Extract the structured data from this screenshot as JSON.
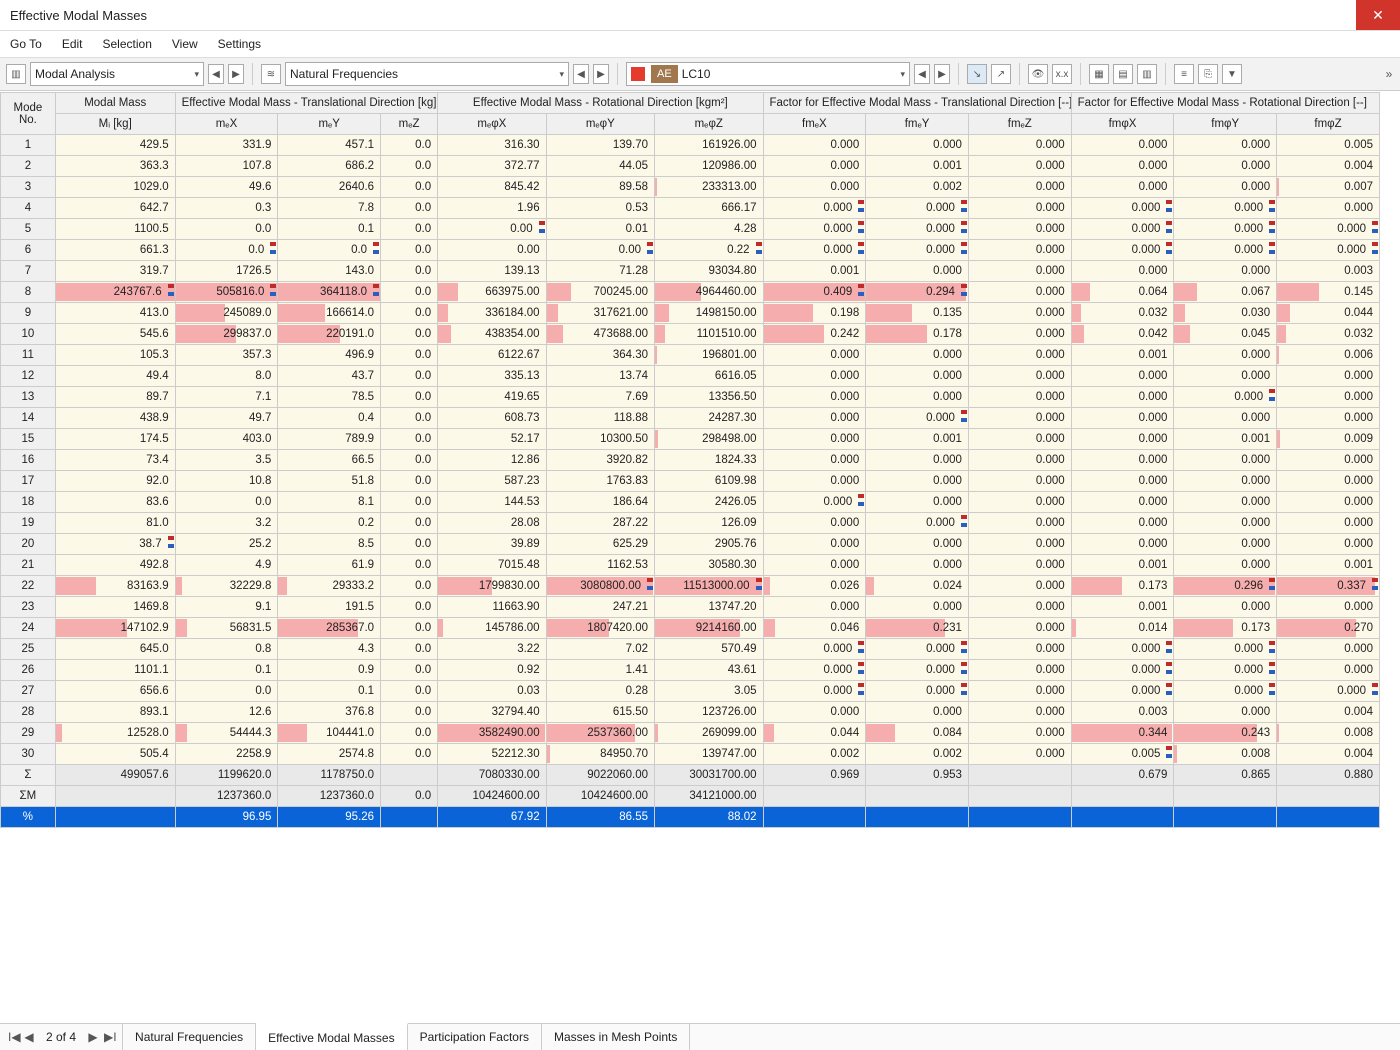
{
  "window": {
    "title": "Effective Modal Masses"
  },
  "menu": [
    "Go To",
    "Edit",
    "Selection",
    "View",
    "Settings"
  ],
  "toolbar": {
    "analysis": "Modal Analysis",
    "result": "Natural Frequencies",
    "case_code": "AE",
    "case": "LC10",
    "swatch": "#e43b2c"
  },
  "pager": {
    "text": "2 of 4"
  },
  "tabs": [
    "Natural Frequencies",
    "Effective Modal Masses",
    "Participation Factors",
    "Masses in Mesh Points"
  ],
  "active_tab": 1,
  "headers": {
    "row": "Mode\nNo.",
    "g1": "Modal Mass",
    "g2": "Effective Modal Mass - Translational Direction [kg]",
    "g3": "Effective Modal Mass - Rotational Direction [kgm²]",
    "g4": "Factor for Effective Modal Mass - Translational Direction [--]",
    "g5": "Factor for Effective Modal Mass - Rotational Direction [--]",
    "cols": [
      "Mᵢ [kg]",
      "mₑX",
      "mₑY",
      "mₑZ",
      "mₑφX",
      "mₑφY",
      "mₑφZ",
      "fmₑX",
      "fmₑY",
      "fmₑZ",
      "fmφX",
      "fmφY",
      "fmφZ"
    ]
  },
  "column_scales": [
    244000,
    506000,
    365000,
    1,
    3600000,
    3100000,
    11600000,
    0.41,
    0.3,
    0.01,
    0.35,
    0.3,
    0.35
  ],
  "rows": [
    {
      "n": "1",
      "v": [
        "429.5",
        "331.9",
        "457.1",
        "0.0",
        "316.30",
        "139.70",
        "161926.00",
        "0.000",
        "0.000",
        "0.000",
        "0.000",
        "0.000",
        "0.005"
      ],
      "f": {}
    },
    {
      "n": "2",
      "v": [
        "363.3",
        "107.8",
        "686.2",
        "0.0",
        "372.77",
        "44.05",
        "120986.00",
        "0.000",
        "0.001",
        "0.000",
        "0.000",
        "0.000",
        "0.004"
      ],
      "f": {}
    },
    {
      "n": "3",
      "v": [
        "1029.0",
        "49.6",
        "2640.6",
        "0.0",
        "845.42",
        "89.58",
        "233313.00",
        "0.000",
        "0.002",
        "0.000",
        "0.000",
        "0.000",
        "0.007"
      ],
      "f": {}
    },
    {
      "n": "4",
      "v": [
        "642.7",
        "0.3",
        "7.8",
        "0.0",
        "1.96",
        "0.53",
        "666.17",
        "0.000",
        "0.000",
        "0.000",
        "0.000",
        "0.000",
        "0.000"
      ],
      "f": {
        "7": 1,
        "8": 1,
        "10": 1,
        "11": 1
      }
    },
    {
      "n": "5",
      "v": [
        "1100.5",
        "0.0",
        "0.1",
        "0.0",
        "0.00",
        "0.01",
        "4.28",
        "0.000",
        "0.000",
        "0.000",
        "0.000",
        "0.000",
        "0.000"
      ],
      "f": {
        "4": 1,
        "7": 1,
        "8": 1,
        "10": 1,
        "11": 1,
        "12": 1
      }
    },
    {
      "n": "6",
      "v": [
        "661.3",
        "0.0",
        "0.0",
        "0.0",
        "0.00",
        "0.00",
        "0.22",
        "0.000",
        "0.000",
        "0.000",
        "0.000",
        "0.000",
        "0.000"
      ],
      "f": {
        "1": 1,
        "2": 1,
        "5": 1,
        "6": 1,
        "7": 1,
        "8": 1,
        "10": 1,
        "11": 1,
        "12": 1
      }
    },
    {
      "n": "7",
      "v": [
        "319.7",
        "1726.5",
        "143.0",
        "0.0",
        "139.13",
        "71.28",
        "93034.80",
        "0.001",
        "0.000",
        "0.000",
        "0.000",
        "0.000",
        "0.003"
      ],
      "f": {}
    },
    {
      "n": "8",
      "v": [
        "243767.6",
        "505816.0",
        "364118.0",
        "0.0",
        "663975.00",
        "700245.00",
        "4964460.00",
        "0.409",
        "0.294",
        "0.000",
        "0.064",
        "0.067",
        "0.145"
      ],
      "f": {
        "0": 1,
        "1": 1,
        "2": 1,
        "7": 1,
        "8": 1
      }
    },
    {
      "n": "9",
      "v": [
        "413.0",
        "245089.0",
        "166614.0",
        "0.0",
        "336184.00",
        "317621.00",
        "1498150.00",
        "0.198",
        "0.135",
        "0.000",
        "0.032",
        "0.030",
        "0.044"
      ],
      "f": {}
    },
    {
      "n": "10",
      "v": [
        "545.6",
        "299837.0",
        "220191.0",
        "0.0",
        "438354.00",
        "473688.00",
        "1101510.00",
        "0.242",
        "0.178",
        "0.000",
        "0.042",
        "0.045",
        "0.032"
      ],
      "f": {}
    },
    {
      "n": "11",
      "v": [
        "105.3",
        "357.3",
        "496.9",
        "0.0",
        "6122.67",
        "364.30",
        "196801.00",
        "0.000",
        "0.000",
        "0.000",
        "0.001",
        "0.000",
        "0.006"
      ],
      "f": {}
    },
    {
      "n": "12",
      "v": [
        "49.4",
        "8.0",
        "43.7",
        "0.0",
        "335.13",
        "13.74",
        "6616.05",
        "0.000",
        "0.000",
        "0.000",
        "0.000",
        "0.000",
        "0.000"
      ],
      "f": {}
    },
    {
      "n": "13",
      "v": [
        "89.7",
        "7.1",
        "78.5",
        "0.0",
        "419.65",
        "7.69",
        "13356.50",
        "0.000",
        "0.000",
        "0.000",
        "0.000",
        "0.000",
        "0.000"
      ],
      "f": {
        "11": 1
      }
    },
    {
      "n": "14",
      "v": [
        "438.9",
        "49.7",
        "0.4",
        "0.0",
        "608.73",
        "118.88",
        "24287.30",
        "0.000",
        "0.000",
        "0.000",
        "0.000",
        "0.000",
        "0.000"
      ],
      "f": {
        "8": 1
      }
    },
    {
      "n": "15",
      "v": [
        "174.5",
        "403.0",
        "789.9",
        "0.0",
        "52.17",
        "10300.50",
        "298498.00",
        "0.000",
        "0.001",
        "0.000",
        "0.000",
        "0.001",
        "0.009"
      ],
      "f": {}
    },
    {
      "n": "16",
      "v": [
        "73.4",
        "3.5",
        "66.5",
        "0.0",
        "12.86",
        "3920.82",
        "1824.33",
        "0.000",
        "0.000",
        "0.000",
        "0.000",
        "0.000",
        "0.000"
      ],
      "f": {}
    },
    {
      "n": "17",
      "v": [
        "92.0",
        "10.8",
        "51.8",
        "0.0",
        "587.23",
        "1763.83",
        "6109.98",
        "0.000",
        "0.000",
        "0.000",
        "0.000",
        "0.000",
        "0.000"
      ],
      "f": {}
    },
    {
      "n": "18",
      "v": [
        "83.6",
        "0.0",
        "8.1",
        "0.0",
        "144.53",
        "186.64",
        "2426.05",
        "0.000",
        "0.000",
        "0.000",
        "0.000",
        "0.000",
        "0.000"
      ],
      "f": {
        "7": 1
      }
    },
    {
      "n": "19",
      "v": [
        "81.0",
        "3.2",
        "0.2",
        "0.0",
        "28.08",
        "287.22",
        "126.09",
        "0.000",
        "0.000",
        "0.000",
        "0.000",
        "0.000",
        "0.000"
      ],
      "f": {
        "8": 1
      }
    },
    {
      "n": "20",
      "v": [
        "38.7",
        "25.2",
        "8.5",
        "0.0",
        "39.89",
        "625.29",
        "2905.76",
        "0.000",
        "0.000",
        "0.000",
        "0.000",
        "0.000",
        "0.000"
      ],
      "f": {
        "0": 1
      }
    },
    {
      "n": "21",
      "v": [
        "492.8",
        "4.9",
        "61.9",
        "0.0",
        "7015.48",
        "1162.53",
        "30580.30",
        "0.000",
        "0.000",
        "0.000",
        "0.001",
        "0.000",
        "0.001"
      ],
      "f": {}
    },
    {
      "n": "22",
      "v": [
        "83163.9",
        "32229.8",
        "29333.2",
        "0.0",
        "1799830.00",
        "3080800.00",
        "11513000.00",
        "0.026",
        "0.024",
        "0.000",
        "0.173",
        "0.296",
        "0.337"
      ],
      "f": {
        "5": 1,
        "6": 1,
        "11": 1,
        "12": 1
      }
    },
    {
      "n": "23",
      "v": [
        "1469.8",
        "9.1",
        "191.5",
        "0.0",
        "11663.90",
        "247.21",
        "13747.20",
        "0.000",
        "0.000",
        "0.000",
        "0.001",
        "0.000",
        "0.000"
      ],
      "f": {}
    },
    {
      "n": "24",
      "v": [
        "147102.9",
        "56831.5",
        "285367.0",
        "0.0",
        "145786.00",
        "1807420.00",
        "9214160.00",
        "0.046",
        "0.231",
        "0.000",
        "0.014",
        "0.173",
        "0.270"
      ],
      "f": {}
    },
    {
      "n": "25",
      "v": [
        "645.0",
        "0.8",
        "4.3",
        "0.0",
        "3.22",
        "7.02",
        "570.49",
        "0.000",
        "0.000",
        "0.000",
        "0.000",
        "0.000",
        "0.000"
      ],
      "f": {
        "7": 1,
        "8": 1,
        "10": 1,
        "11": 1
      }
    },
    {
      "n": "26",
      "v": [
        "1101.1",
        "0.1",
        "0.9",
        "0.0",
        "0.92",
        "1.41",
        "43.61",
        "0.000",
        "0.000",
        "0.000",
        "0.000",
        "0.000",
        "0.000"
      ],
      "f": {
        "7": 1,
        "8": 1,
        "10": 1,
        "11": 1
      }
    },
    {
      "n": "27",
      "v": [
        "656.6",
        "0.0",
        "0.1",
        "0.0",
        "0.03",
        "0.28",
        "3.05",
        "0.000",
        "0.000",
        "0.000",
        "0.000",
        "0.000",
        "0.000"
      ],
      "f": {
        "7": 1,
        "8": 1,
        "10": 1,
        "11": 1,
        "12": 1
      }
    },
    {
      "n": "28",
      "v": [
        "893.1",
        "12.6",
        "376.8",
        "0.0",
        "32794.40",
        "615.50",
        "123726.00",
        "0.000",
        "0.000",
        "0.000",
        "0.003",
        "0.000",
        "0.004"
      ],
      "f": {}
    },
    {
      "n": "29",
      "v": [
        "12528.0",
        "54444.3",
        "104441.0",
        "0.0",
        "3582490.00",
        "2537360.00",
        "269099.00",
        "0.044",
        "0.084",
        "0.000",
        "0.344",
        "0.243",
        "0.008"
      ],
      "f": {}
    },
    {
      "n": "30",
      "v": [
        "505.4",
        "2258.9",
        "2574.8",
        "0.0",
        "52212.30",
        "84950.70",
        "139747.00",
        "0.002",
        "0.002",
        "0.000",
        "0.005",
        "0.008",
        "0.004"
      ],
      "f": {
        "10": 1
      }
    }
  ],
  "summary": [
    {
      "n": "Σ",
      "v": [
        "499057.6",
        "1199620.0",
        "1178750.0",
        "",
        "7080330.00",
        "9022060.00",
        "30031700.00",
        "0.969",
        "0.953",
        "",
        "0.679",
        "0.865",
        "0.880"
      ]
    },
    {
      "n": "ΣM",
      "v": [
        "",
        "1237360.0",
        "1237360.0",
        "0.0",
        "10424600.00",
        "10424600.00",
        "34121000.00",
        "",
        "",
        "",
        "",
        "",
        ""
      ]
    },
    {
      "n": "%",
      "v": [
        "",
        "96.95",
        "95.26",
        "",
        "67.92",
        "86.55",
        "88.02",
        "",
        "",
        "",
        "",
        "",
        ""
      ],
      "sel": true
    }
  ]
}
